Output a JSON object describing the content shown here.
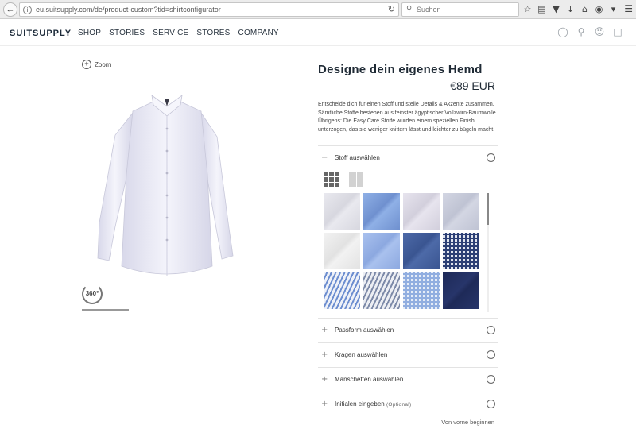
{
  "browser": {
    "url": "eu.suitsupply.com/de/product-custom?tid=shirtconfigurator",
    "search_placeholder": "Suchen"
  },
  "site": {
    "logo": "SUITSUPPLY",
    "nav": [
      "SHOP",
      "STORIES",
      "SERVICE",
      "STORES",
      "COMPANY"
    ]
  },
  "product": {
    "zoom_label": "Zoom",
    "rotate_label": "360°",
    "title": "Designe dein eigenes Hemd",
    "price": "€89 EUR",
    "description": "Entscheide dich für einen Stoff und stelle Details & Akzente zusammen. Sämtliche Stoffe bestehen aus feinster ägyptischer Vollzwirn-Baumwolle. Übrigens: Die Easy Care Stoffe wurden einem speziellen Finish unterzogen, das sie weniger knittern lässt und leichter zu bügeln macht."
  },
  "sections": {
    "fabric": {
      "label": "Stoff auswählen",
      "symbol": "−"
    },
    "fit": {
      "label": "Passform auswählen",
      "symbol": "+"
    },
    "collar": {
      "label": "Kragen auswählen",
      "symbol": "+"
    },
    "cuffs": {
      "label": "Manschetten auswählen",
      "symbol": "+"
    },
    "initials": {
      "label": "Initialen eingeben",
      "optional": "(Optional)",
      "symbol": "+"
    }
  },
  "swatches": [
    {
      "name": "white-twill",
      "base": "#e9e9ef",
      "line": "#d7d7df",
      "pattern": "diag"
    },
    {
      "name": "blue-twill",
      "base": "#8fb0e6",
      "line": "#6f90cf",
      "pattern": "diag"
    },
    {
      "name": "lilac-white",
      "base": "#e7e4ee",
      "line": "#d2cfdc",
      "pattern": "diag"
    },
    {
      "name": "light-grey-blue",
      "base": "#d3d6e3",
      "line": "#bfc3d3",
      "pattern": "diag"
    },
    {
      "name": "white-plain",
      "base": "#f2f2f2",
      "line": "#e2e2e2",
      "pattern": "diag"
    },
    {
      "name": "sky-blue",
      "base": "#a9c1ee",
      "line": "#8ca8e0",
      "pattern": "diag"
    },
    {
      "name": "navy-oxford",
      "base": "#4d6aa8",
      "line": "#3a5591",
      "pattern": "diag"
    },
    {
      "name": "navy-gingham",
      "base": "#e0e4ee",
      "line": "#2c3f75",
      "pattern": "check"
    },
    {
      "name": "blue-stripe",
      "base": "#eef1f8",
      "line": "#6d8ed0",
      "pattern": "stripe"
    },
    {
      "name": "grey-stripe",
      "base": "#eceef3",
      "line": "#7d8aa8",
      "pattern": "stripe"
    },
    {
      "name": "light-blue-check",
      "base": "#e5ecf7",
      "line": "#91aee0",
      "pattern": "check"
    },
    {
      "name": "navy-solid",
      "base": "#1e2a58",
      "line": "#27356a",
      "pattern": "diag"
    }
  ],
  "footer": {
    "restart": "Von vorne beginnen"
  }
}
